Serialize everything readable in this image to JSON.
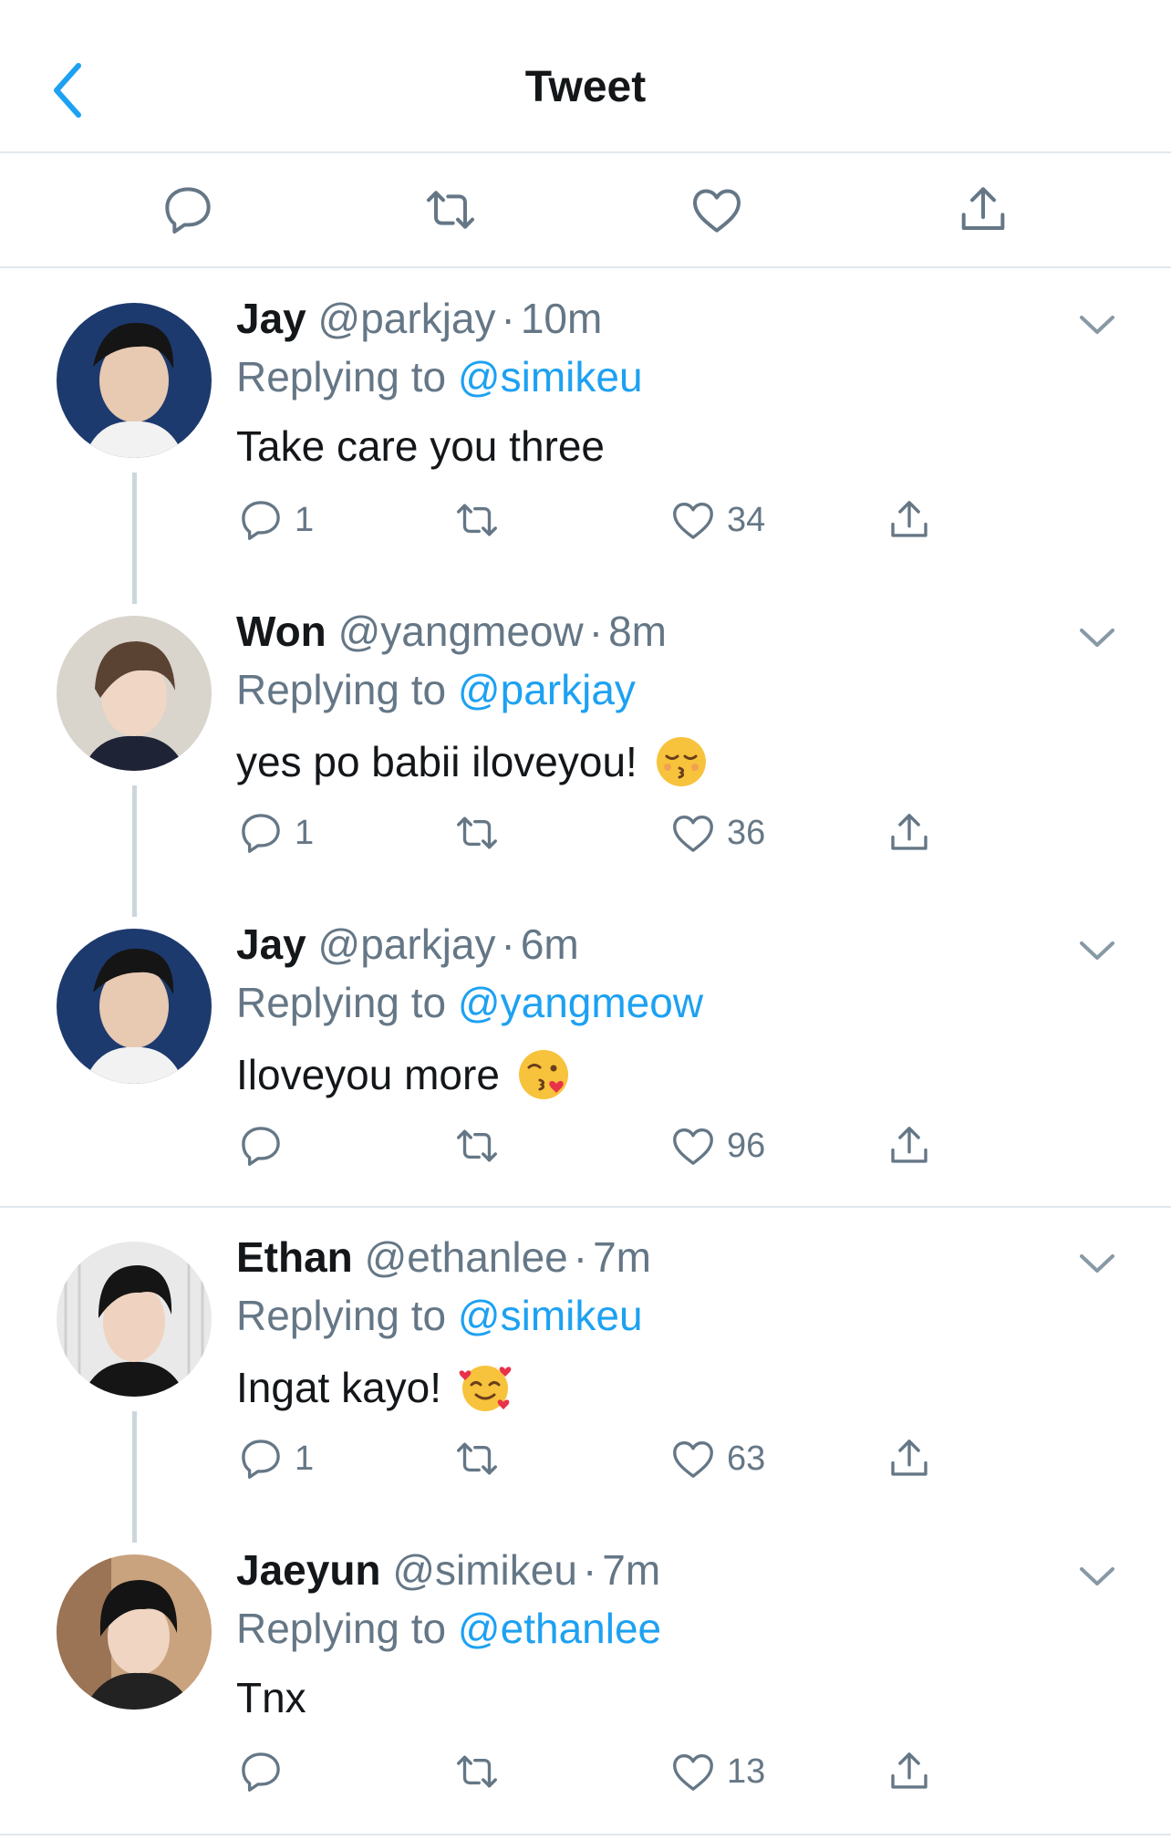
{
  "header": {
    "title": "Tweet"
  },
  "action_bar": {
    "icons": [
      "reply-icon",
      "retweet-icon",
      "like-icon",
      "share-icon"
    ]
  },
  "colors": {
    "accent": "#1da1f2",
    "muted": "#657786",
    "divider": "#e1e8ed"
  },
  "tweets": [
    {
      "name": "Jay",
      "handle": "@parkjay",
      "dot": "·",
      "time": "10m",
      "replying_prefix": "Replying to",
      "mention": "@simikeu",
      "text": "Take care you three",
      "emoji": "",
      "reply_count": "1",
      "like_count": "34"
    },
    {
      "name": "Won",
      "handle": "@yangmeow",
      "dot": "·",
      "time": "8m",
      "replying_prefix": "Replying to",
      "mention": "@parkjay",
      "text": "yes po babii iloveyou!",
      "emoji": "kissing-closed-eyes-emoji",
      "reply_count": "1",
      "like_count": "36"
    },
    {
      "name": "Jay",
      "handle": "@parkjay",
      "dot": "·",
      "time": "6m",
      "replying_prefix": "Replying to",
      "mention": "@yangmeow",
      "text": "Iloveyou more",
      "emoji": "face-blowing-kiss-emoji",
      "reply_count": "",
      "like_count": "96"
    },
    {
      "name": "Ethan",
      "handle": "@ethanlee",
      "dot": "·",
      "time": "7m",
      "replying_prefix": "Replying to",
      "mention": "@simikeu",
      "text": "Ingat kayo!",
      "emoji": "smiling-face-with-hearts-emoji",
      "reply_count": "1",
      "like_count": "63"
    },
    {
      "name": "Jaeyun",
      "handle": "@simikeu",
      "dot": "·",
      "time": "7m",
      "replying_prefix": "Replying to",
      "mention": "@ethanlee",
      "text": "Tnx",
      "emoji": "",
      "reply_count": "",
      "like_count": "13"
    }
  ]
}
